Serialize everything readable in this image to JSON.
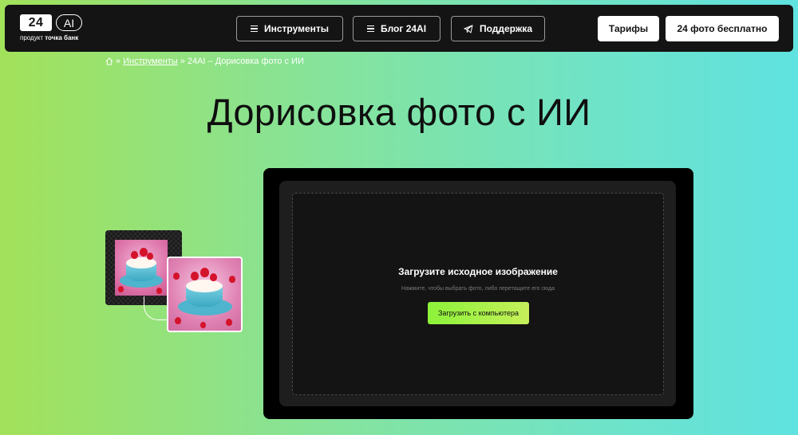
{
  "header": {
    "logo": {
      "mark": "24",
      "ai": "AI",
      "sub_prefix": "продукт",
      "sub_brand": "точка банк"
    },
    "nav": [
      {
        "label": "Инструменты",
        "icon": "menu-icon"
      },
      {
        "label": "Блог 24AI",
        "icon": "menu-icon"
      },
      {
        "label": "Поддержка",
        "icon": "telegram-icon"
      }
    ],
    "pricing_label": "Тарифы",
    "free_label": "24 фото бесплатно"
  },
  "breadcrumb": {
    "home_icon": "home-icon",
    "sep": "»",
    "tools": "Инструменты",
    "current": "24AI – Дорисовка фото с ИИ"
  },
  "page": {
    "title": "Дорисовка фото с ИИ"
  },
  "uploader": {
    "title": "Загрузите исходное изображение",
    "hint": "Нажмите, чтобы выбрать фото, либо перетащите его сюда",
    "button_label": "Загрузить с компьютера"
  },
  "colors": {
    "topbar": "#141414",
    "accent": "#a6f041"
  }
}
